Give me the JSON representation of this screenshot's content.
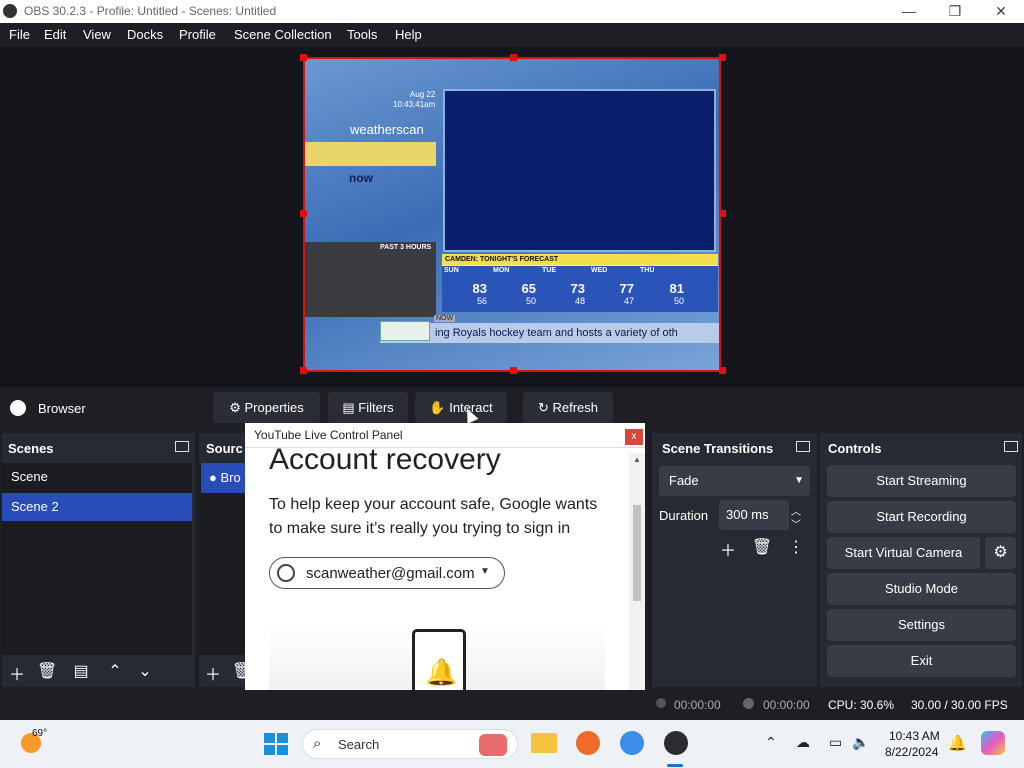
{
  "window": {
    "title": "OBS 30.2.3 - Profile: Untitled - Scenes: Untitled",
    "minimize": "—",
    "maximize": "❐",
    "close": "✕"
  },
  "menu": [
    "File",
    "Edit",
    "View",
    "Docks",
    "Profile",
    "Scene Collection",
    "Tools",
    "Help"
  ],
  "weather": {
    "date": "Aug 22",
    "time": "10:43:41am",
    "logo": "weatherscan",
    "now": "now",
    "past": "PAST 3 HOURS",
    "forecast_title": "CAMDEN:   TONIGHT'S FORECAST",
    "days": [
      {
        "name": "SUN",
        "hi": "83",
        "lo": "56"
      },
      {
        "name": "MON",
        "hi": "65",
        "lo": "50"
      },
      {
        "name": "TUE",
        "hi": "73",
        "lo": "48"
      },
      {
        "name": "WED",
        "hi": "77",
        "lo": "47"
      },
      {
        "name": "THU",
        "hi": "81",
        "lo": "50"
      }
    ],
    "now_tag": "NOW",
    "ticker": "ing Royals hockey team and hosts a variety of oth"
  },
  "source_toolbar": {
    "source_name": "Browser",
    "properties": "Properties",
    "filters": "Filters",
    "interact": "Interact",
    "refresh": "Refresh"
  },
  "scenes": {
    "title": "Scenes",
    "items": [
      "Scene",
      "Scene 2"
    ],
    "selected": "Scene 2"
  },
  "sources": {
    "title": "Sourc",
    "item": "Bro"
  },
  "transitions": {
    "title": "Scene Transitions",
    "selected": "Fade",
    "duration_label": "Duration",
    "duration_value": "300 ms"
  },
  "controls": {
    "title": "Controls",
    "start_streaming": "Start Streaming",
    "start_recording": "Start Recording",
    "start_virtual_camera": "Start Virtual Camera",
    "studio_mode": "Studio Mode",
    "settings": "Settings",
    "exit": "Exit"
  },
  "popup": {
    "title": "YouTube Live Control Panel",
    "close": "x",
    "heading": "Account recovery",
    "body": "To help keep your account safe, Google wants to make sure it’s really you trying to sign in",
    "email": "scanweather@gmail.com"
  },
  "status": {
    "stream_time": "00:00:00",
    "rec_time": "00:00:00",
    "cpu": "CPU: 30.6%",
    "fps": "30.00 / 30.00 FPS"
  },
  "taskbar": {
    "temp": "69°",
    "search": "Search",
    "time": "10:43 AM",
    "date": "8/22/2024"
  }
}
